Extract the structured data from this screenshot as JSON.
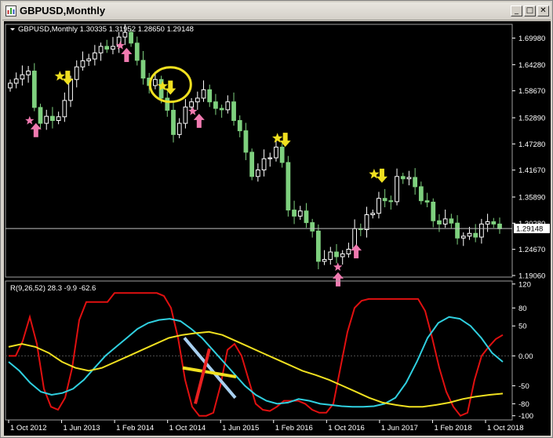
{
  "window": {
    "title": "GBPUSD,Monthly",
    "buttons": [
      "_",
      "□",
      "✕"
    ]
  },
  "chart_data": [
    {
      "type": "candlestick",
      "header": "GBPUSD,Monthly  1.30335 1.31952 1.28650 1.29148",
      "symbol": "GBPUSD,Monthly",
      "ohlc_current": {
        "open": "1.30335",
        "high": "1.31952",
        "low": "1.28650",
        "close": "1.29148"
      },
      "current_price_label": "1.29148",
      "y_ticks": [
        "1.69980",
        "1.64280",
        "1.58670",
        "1.52890",
        "1.47280",
        "1.41670",
        "1.35890",
        "1.30280",
        "1.24670",
        "1.19060"
      ],
      "ylim": [
        1.1906,
        1.7225
      ],
      "up_color": "#ffffff",
      "down_color": "#7ed07e",
      "close_line_color": "#c0c0c0",
      "closes": [
        1.603,
        1.612,
        1.621,
        1.629,
        1.551,
        1.517,
        1.532,
        1.523,
        1.531,
        1.566,
        1.611,
        1.638,
        1.651,
        1.655,
        1.668,
        1.682,
        1.676,
        1.682,
        1.702,
        1.712,
        1.689,
        1.652,
        1.614,
        1.598,
        1.611,
        1.571,
        1.545,
        1.493,
        1.517,
        1.552,
        1.563,
        1.571,
        1.589,
        1.563,
        1.549,
        1.546,
        1.563,
        1.523,
        1.501,
        1.455,
        1.403,
        1.417,
        1.441,
        1.443,
        1.466,
        1.433,
        1.331,
        1.318,
        1.329,
        1.304,
        1.286,
        1.221,
        1.225,
        1.241,
        1.231,
        1.237,
        1.247,
        1.291,
        1.289,
        1.321,
        1.324,
        1.356,
        1.351,
        1.349,
        1.403,
        1.398,
        1.401,
        1.381,
        1.351,
        1.348,
        1.308,
        1.301,
        1.312,
        1.303,
        1.271,
        1.275,
        1.281,
        1.273,
        1.301,
        1.306,
        1.301,
        1.291
      ],
      "x_ticks": [
        "1 Oct 2012",
        "1 Jun 2013",
        "1 Feb 2014",
        "1 Oct 2014",
        "1 Jun 2015",
        "1 Feb 2016",
        "1 Oct 2016",
        "1 Jun 2017",
        "1 Feb 2018",
        "1 Oct 2018"
      ],
      "arrows_up": [
        4,
        19,
        31,
        54,
        57
      ],
      "arrows_down": [
        9,
        26,
        45,
        61
      ],
      "stars_yellow": [
        9,
        26,
        45,
        61
      ],
      "stars_pink": [
        4,
        19,
        31,
        55
      ],
      "highlight_circle_index": 26
    },
    {
      "type": "line",
      "header": "R(9,26,52) 28.3 -9.9 -62.6",
      "y_ticks": [
        "120",
        "80",
        "50",
        "0.00",
        "-50",
        "-80",
        "-100"
      ],
      "ylim": [
        -107,
        125
      ],
      "series": [
        {
          "name": "",
          "color": "#e01010",
          "values": [
            0,
            0,
            25,
            65,
            20,
            -55,
            -85,
            -90,
            -70,
            -20,
            60,
            90,
            90,
            90,
            90,
            105,
            105,
            105,
            105,
            105,
            105,
            105,
            100,
            80,
            30,
            -40,
            -85,
            -100,
            -100,
            -95,
            -50,
            10,
            20,
            0,
            -40,
            -80,
            -90,
            -92,
            -85,
            -75,
            -75,
            -75,
            -80,
            -90,
            -95,
            -95,
            -80,
            -20,
            40,
            80,
            92,
            95,
            95,
            95,
            95,
            95,
            95,
            95,
            95,
            75,
            30,
            -20,
            -60,
            -85,
            -100,
            -95,
            -40,
            0,
            15,
            28,
            35
          ]
        },
        {
          "name": "",
          "color": "#30d0e0",
          "values": [
            -10,
            -25,
            -45,
            -60,
            -65,
            -62,
            -55,
            -40,
            -20,
            0,
            15,
            30,
            45,
            55,
            60,
            62,
            58,
            45,
            30,
            10,
            -10,
            -30,
            -50,
            -65,
            -75,
            -80,
            -78,
            -72,
            -75,
            -80,
            -82,
            -84,
            -85,
            -85,
            -84,
            -80,
            -70,
            -45,
            -10,
            30,
            55,
            65,
            62,
            50,
            30,
            5,
            -10
          ]
        },
        {
          "name": "",
          "color": "#f0e020",
          "values": [
            15,
            20,
            15,
            5,
            -10,
            -20,
            -25,
            -20,
            -10,
            0,
            10,
            20,
            30,
            35,
            38,
            40,
            35,
            25,
            15,
            5,
            -5,
            -15,
            -25,
            -32,
            -40,
            -50,
            -60,
            -70,
            -78,
            -82,
            -85,
            -85,
            -82,
            -78,
            -72,
            -68,
            -65,
            -63
          ]
        }
      ],
      "annotations": {
        "cross_color_red": "#e82020",
        "cross_color_blue": "#a8d0f0",
        "cross_color_yellow": "#f0e020"
      }
    }
  ]
}
